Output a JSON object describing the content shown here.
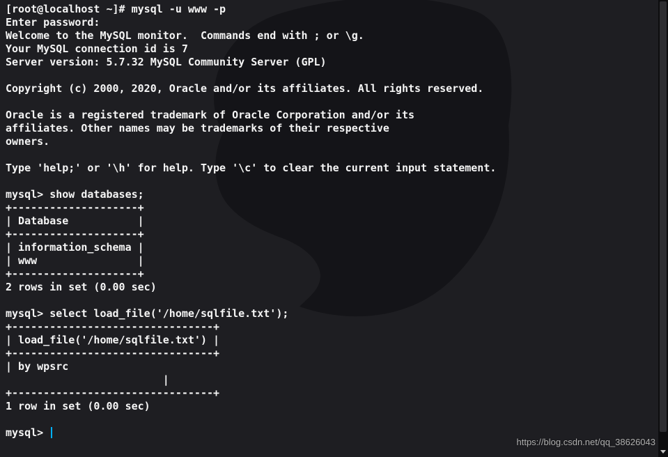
{
  "wallpaper": {
    "base": "#1e1e22",
    "dragon_color": "#141417"
  },
  "shell": {
    "prompt": "[root@localhost ~]# ",
    "command": "mysql -u www -p"
  },
  "mysql_login": {
    "enter_pw": "Enter password:",
    "welcome": "Welcome to the MySQL monitor.  Commands end with ; or \\g.",
    "conn_id": "Your MySQL connection id is 7",
    "server": "Server version: 5.7.32 MySQL Community Server (GPL)",
    "copyright": "Copyright (c) 2000, 2020, Oracle and/or its affiliates. All rights reserved.",
    "trademark1": "Oracle is a registered trademark of Oracle Corporation and/or its",
    "trademark2": "affiliates. Other names may be trademarks of their respective",
    "trademark3": "owners.",
    "help": "Type 'help;' or '\\h' for help. Type '\\c' to clear the current input statement."
  },
  "session": {
    "prompt": "mysql> ",
    "cmd1": "show databases;",
    "tbl1_border": "+--------------------+",
    "tbl1_header": "| Database           |",
    "tbl1_row1": "| information_schema |",
    "tbl1_row2": "| www                |",
    "tbl1_footer": "2 rows in set (0.00 sec)",
    "cmd2": "select load_file('/home/sqlfile.txt');",
    "tbl2_border": "+--------------------------------+",
    "tbl2_header": "| load_file('/home/sqlfile.txt') |",
    "tbl2_row1": "| by wpsrc",
    "tbl2_row2": "                         |",
    "tbl2_footer": "1 row in set (0.00 sec)"
  },
  "watermark": "https://blog.csdn.net/qq_38626043"
}
